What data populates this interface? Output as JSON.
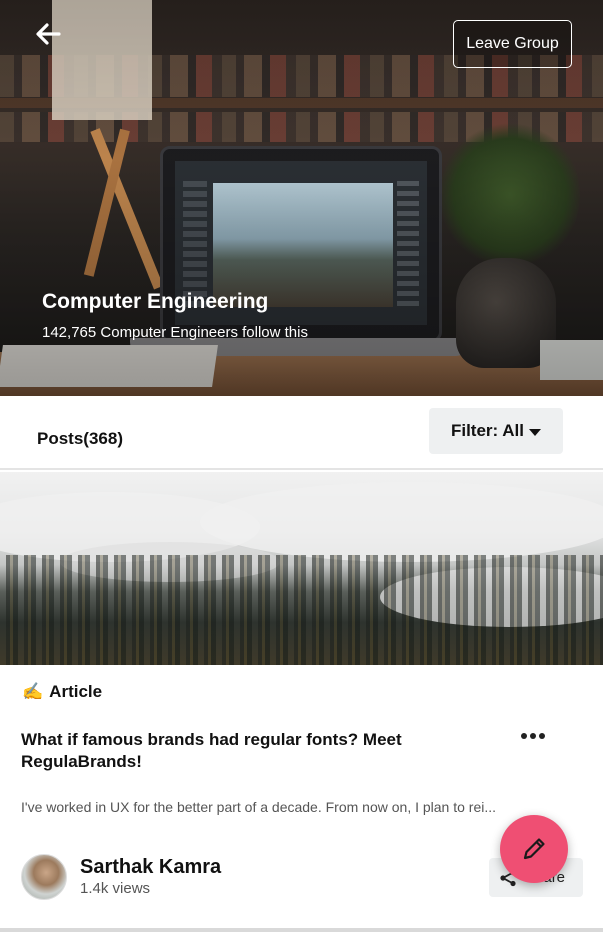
{
  "header": {
    "leave_label": "Leave Group",
    "group_title": "Computer Engineering",
    "group_subtitle": "142,765 Computer Engineers follow this",
    "back_icon": "arrow-left-icon"
  },
  "posts_bar": {
    "posts_label": "Posts(368)",
    "filter_label": "Filter: All"
  },
  "post": {
    "tag_emoji": "✍️",
    "tag_label": "Article",
    "title": "What if famous brands had regular fonts? Meet RegulaBrands!",
    "excerpt": "I've worked in UX for the better part of a decade. From now on, I plan to rei...",
    "author": {
      "name": "Sarthak Kamra",
      "views": "1.4k views"
    },
    "share_label": "Share"
  },
  "colors": {
    "fab": "#ef4f73",
    "chip_bg": "#eef0f1"
  },
  "icons": {
    "fab": "pencil-icon",
    "share": "share-icon",
    "more": "more-dots-icon"
  }
}
